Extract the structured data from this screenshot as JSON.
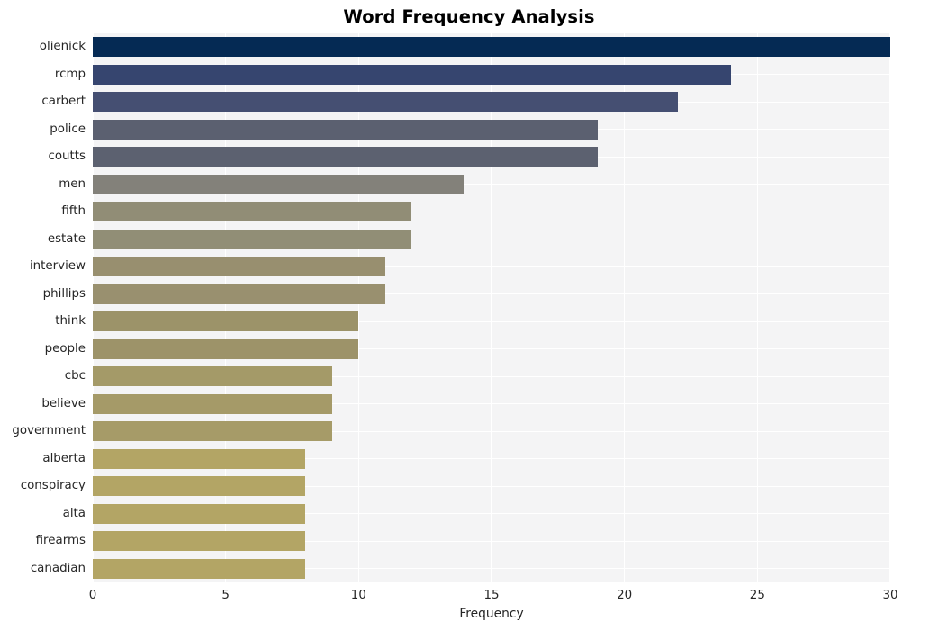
{
  "chart_data": {
    "type": "bar",
    "orientation": "horizontal",
    "title": "Word Frequency Analysis",
    "xlabel": "Frequency",
    "ylabel": "",
    "categories": [
      "olienick",
      "rcmp",
      "carbert",
      "police",
      "coutts",
      "men",
      "fifth",
      "estate",
      "interview",
      "phillips",
      "think",
      "people",
      "cbc",
      "believe",
      "government",
      "alberta",
      "conspiracy",
      "alta",
      "firearms",
      "canadian"
    ],
    "values": [
      30,
      24,
      22,
      19,
      19,
      14,
      12,
      12,
      11,
      11,
      10,
      10,
      9,
      9,
      9,
      8,
      8,
      8,
      8,
      8
    ],
    "xlim": [
      0,
      30
    ],
    "xticks": [
      0,
      5,
      10,
      15,
      20,
      25,
      30
    ],
    "xtick_labels": [
      "0",
      "5",
      "10",
      "15",
      "20",
      "25",
      "30"
    ],
    "grid": true,
    "legend": false,
    "colormap": "cividis",
    "bar_colors": [
      "#052a54",
      "#36456f",
      "#454f72",
      "#5b6070",
      "#5c6170",
      "#83817a",
      "#918d76",
      "#918e76",
      "#988f6f",
      "#99906f",
      "#9c9369",
      "#9d9369",
      "#a49a68",
      "#a59a68",
      "#a69b68",
      "#b3a565",
      "#b3a565",
      "#b3a565",
      "#b3a565",
      "#b3a565"
    ],
    "plot_background": "#f4f4f5",
    "grid_color": "#ffffff",
    "text_color": "#262626"
  }
}
